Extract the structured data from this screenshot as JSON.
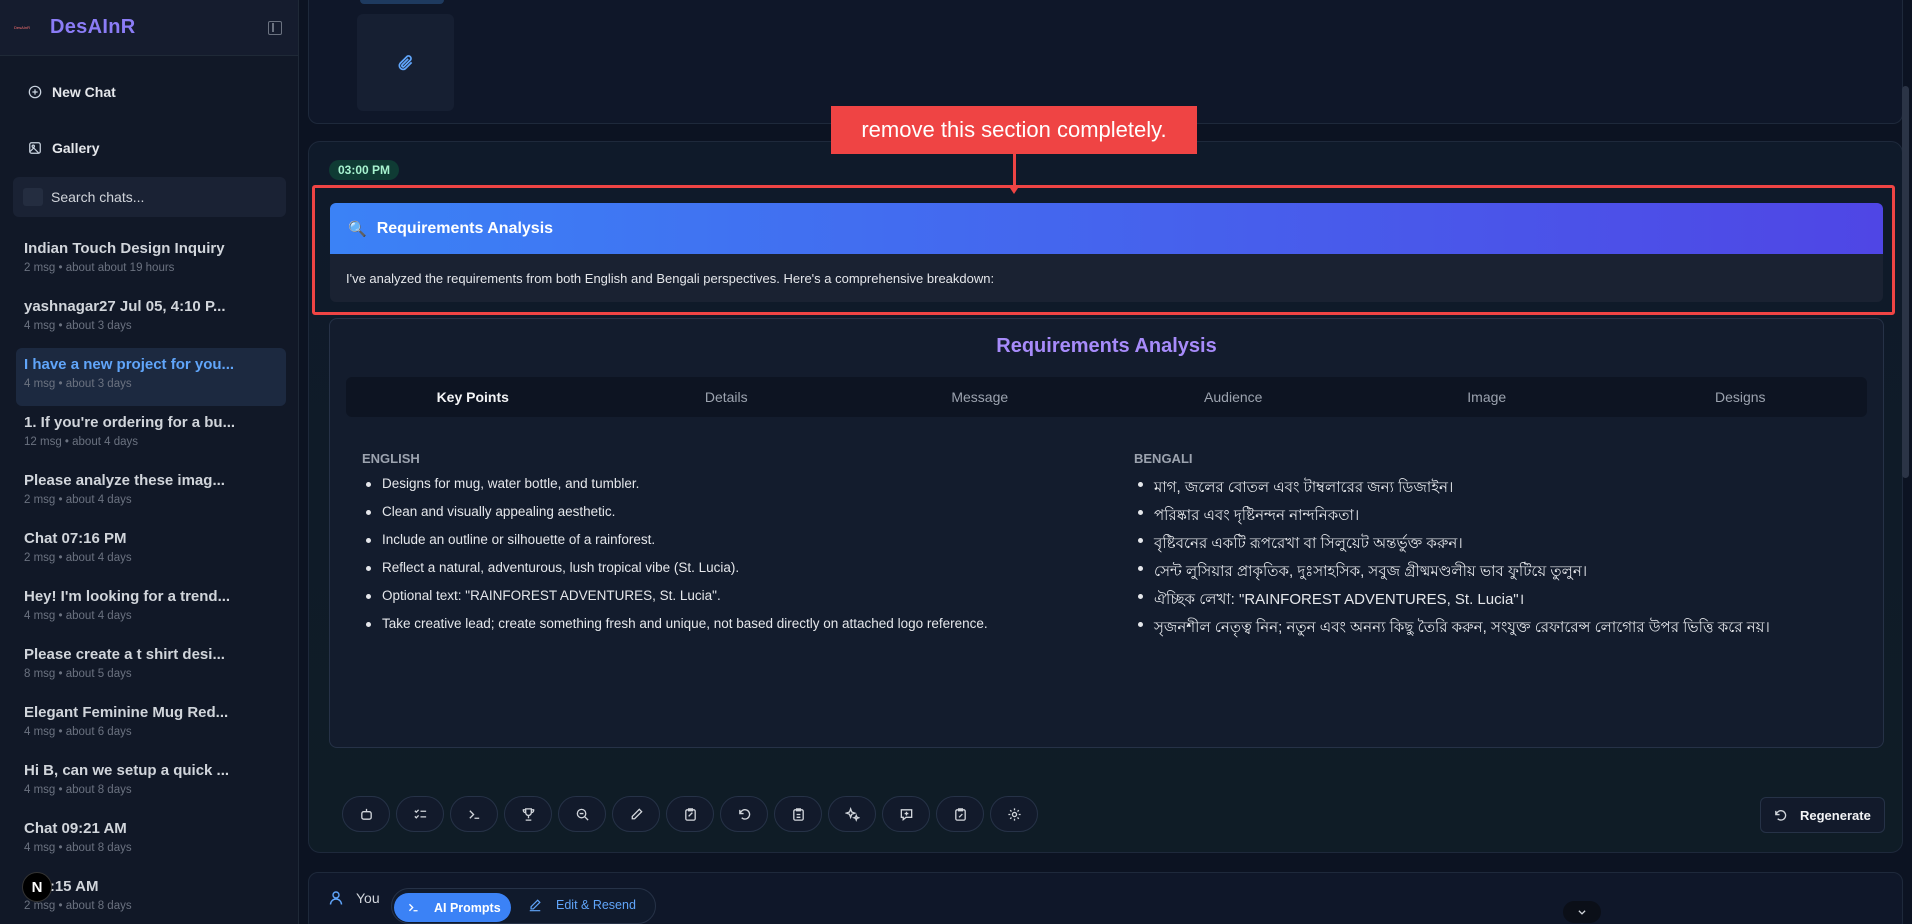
{
  "sidebar": {
    "brand": "DesAInR",
    "brand_logo_text": "DesAInR",
    "new_chat": "New Chat",
    "gallery": "Gallery",
    "search_placeholder": "Search chats...",
    "chats": [
      {
        "title": "Indian Touch Design Inquiry",
        "meta": "2 msg • about about 19 hours"
      },
      {
        "title": "yashnagar27 Jul 05, 4:10 P...",
        "meta": "4 msg • about 3 days"
      },
      {
        "title": "I have a new project for you...",
        "meta": "4 msg • about 3 days",
        "active": true
      },
      {
        "title": "1. If you're ordering for a bu...",
        "meta": "12 msg • about 4 days"
      },
      {
        "title": "Please analyze these imag...",
        "meta": "2 msg • about 4 days"
      },
      {
        "title": "Chat 07:16 PM",
        "meta": "2 msg • about 4 days"
      },
      {
        "title": "Hey! I'm looking for a trend...",
        "meta": "4 msg • about 4 days"
      },
      {
        "title": "Please create a t shirt desi...",
        "meta": "8 msg • about 5 days"
      },
      {
        "title": "Elegant Feminine Mug Red...",
        "meta": "4 msg • about 6 days"
      },
      {
        "title": "Hi B, can we setup a quick ...",
        "meta": "4 msg • about 8 days"
      },
      {
        "title": "Chat 09:21 AM",
        "meta": "4 msg • about 8 days"
      },
      {
        "title": "t 09:15 AM",
        "meta": "2 msg • about 8 days"
      }
    ],
    "n_badge": "N"
  },
  "message": {
    "time": "03:00 PM",
    "header_title": "Requirements Analysis",
    "intro": "I've analyzed the requirements from both English and Bengali perspectives. Here's a comprehensive breakdown:",
    "annotation": "remove this section completely."
  },
  "analysis": {
    "title": "Requirements Analysis",
    "tabs": [
      "Key Points",
      "Details",
      "Message",
      "Audience",
      "Image",
      "Designs"
    ],
    "english_heading": "ENGLISH",
    "english": [
      "Designs for mug, water bottle, and tumbler.",
      "Clean and visually appealing aesthetic.",
      "Include an outline or silhouette of a rainforest.",
      "Reflect a natural, adventurous, lush tropical vibe (St. Lucia).",
      "Optional text: \"RAINFOREST ADVENTURES, St. Lucia\".",
      "Take creative lead; create something fresh and unique, not based directly on attached logo reference."
    ],
    "bengali_heading": "BENGALI",
    "bengali": [
      "মাগ, জলের বোতল এবং টাম্বলারের জন্য ডিজাইন।",
      "পরিষ্কার এবং দৃষ্টিনন্দন নান্দনিকতা।",
      "বৃষ্টিবনের একটি রূপরেখা বা সিলুয়েট অন্তর্ভুক্ত করুন।",
      "সেন্ট লুসিয়ার প্রাকৃতিক, দুঃসাহসিক, সবুজ গ্রীষ্মমণ্ডলীয় ভাব ফুটিয়ে তুলুন।",
      "ঐচ্ছিক লেখা: \"RAINFOREST ADVENTURES, St. Lucia\"।",
      "সৃজনশীল নেতৃত্ব নিন; নতুন এবং অনন্য কিছু তৈরি করুন, সংযুক্ত রেফারেন্স লোগোর উপর ভিত্তি করে নয়।"
    ]
  },
  "toolbar": {
    "regenerate": "Regenerate"
  },
  "composer": {
    "you": "You",
    "ai_prompts": "AI Prompts",
    "edit_resend": "Edit & Resend"
  }
}
